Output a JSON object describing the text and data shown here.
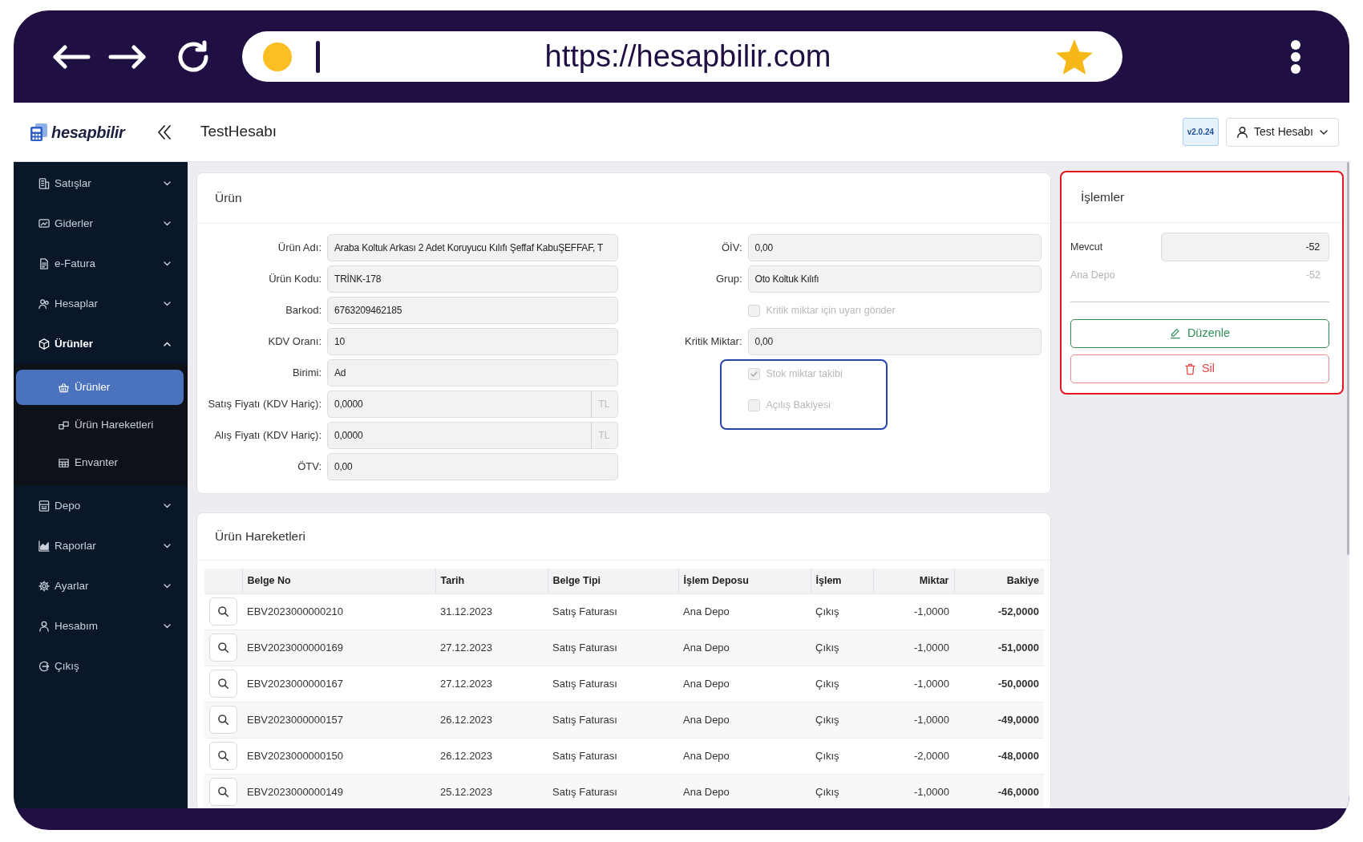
{
  "browser": {
    "url": "https://hesapbilir.com"
  },
  "header": {
    "logo": "hesapbilir",
    "title": "TestHesabı",
    "version": "v2.0.24",
    "user": "Test Hesabı"
  },
  "sidebar": {
    "items": [
      {
        "kind": "menu",
        "label": "Satışlar",
        "expanded": false
      },
      {
        "kind": "menu",
        "label": "Giderler",
        "expanded": false
      },
      {
        "kind": "menu",
        "label": "e-Fatura",
        "expanded": false
      },
      {
        "kind": "menu",
        "label": "Hesaplar",
        "expanded": false
      },
      {
        "kind": "menu",
        "label": "Ürünler",
        "expanded": true,
        "children": [
          {
            "label": "Ürünler",
            "selected": true
          },
          {
            "label": "Ürün Hareketleri",
            "selected": false
          },
          {
            "label": "Envanter",
            "selected": false
          }
        ]
      },
      {
        "kind": "menu",
        "label": "Depo",
        "expanded": false
      },
      {
        "kind": "menu",
        "label": "Raporlar",
        "expanded": false
      },
      {
        "kind": "menu",
        "label": "Ayarlar",
        "expanded": false
      },
      {
        "kind": "menu",
        "label": "Hesabım",
        "expanded": false
      },
      {
        "kind": "link",
        "label": "Çıkış"
      }
    ]
  },
  "product": {
    "title": "Ürün",
    "left_fields": [
      {
        "label": "Ürün Adı:",
        "value": "Araba Koltuk Arkası 2 Adet Koruyucu Kılıfı Şeffaf KabuŞEFFAF, T"
      },
      {
        "label": "Ürün Kodu:",
        "value": "TRİNK-178"
      },
      {
        "label": "Barkod:",
        "value": "6763209462185"
      },
      {
        "label": "KDV Oranı:",
        "value": "10"
      },
      {
        "label": "Birimi:",
        "value": "Ad"
      },
      {
        "label": "Satış Fiyatı (KDV Hariç):",
        "value": "0,0000",
        "suffix": "TL"
      },
      {
        "label": "Alış Fiyatı (KDV Hariç):",
        "value": "0,0000",
        "suffix": "TL"
      },
      {
        "label": "ÖTV:",
        "value": "0,00"
      }
    ],
    "right_fields": [
      {
        "kind": "field",
        "label": "ÖİV:",
        "value": "0,00"
      },
      {
        "kind": "field",
        "label": "Grup:",
        "value": "Oto Koltuk Kılıfı"
      },
      {
        "kind": "checkbox",
        "label": "Kritik miktar için uyarı gönder",
        "checked": false,
        "disabled": true
      },
      {
        "kind": "field",
        "label": "Kritik Miktar:",
        "value": "0,00"
      },
      {
        "kind": "group",
        "highlighted": true,
        "items": [
          {
            "label": "Stok miktar takibi",
            "checked": true,
            "disabled": true
          },
          {
            "label": "Açılış Bakiyesi",
            "checked": false,
            "disabled": true
          }
        ]
      }
    ]
  },
  "actions": {
    "title": "İşlemler",
    "highlighted": true,
    "stock_label": "Mevcut",
    "stock_value": "-52",
    "warehouses": [
      {
        "name": "Ana Depo",
        "value": "-52"
      }
    ],
    "buttons": [
      {
        "kind": "edit",
        "label": "Düzenle"
      },
      {
        "kind": "delete",
        "label": "Sil"
      }
    ]
  },
  "movements": {
    "title": "Ürün Hareketleri",
    "columns": [
      "Belge No",
      "Tarih",
      "Belge Tipi",
      "İşlem Deposu",
      "İşlem",
      "Miktar",
      "Bakiye"
    ],
    "rows": [
      [
        "EBV2023000000210",
        "31.12.2023",
        "Satış Faturası",
        "Ana Depo",
        "Çıkış",
        "-1,0000",
        "-52,0000"
      ],
      [
        "EBV2023000000169",
        "27.12.2023",
        "Satış Faturası",
        "Ana Depo",
        "Çıkış",
        "-1,0000",
        "-51,0000"
      ],
      [
        "EBV2023000000167",
        "27.12.2023",
        "Satış Faturası",
        "Ana Depo",
        "Çıkış",
        "-1,0000",
        "-50,0000"
      ],
      [
        "EBV2023000000157",
        "26.12.2023",
        "Satış Faturası",
        "Ana Depo",
        "Çıkış",
        "-1,0000",
        "-49,0000"
      ],
      [
        "EBV2023000000150",
        "26.12.2023",
        "Satış Faturası",
        "Ana Depo",
        "Çıkış",
        "-2,0000",
        "-48,0000"
      ],
      [
        "EBV2023000000149",
        "25.12.2023",
        "Satış Faturası",
        "Ana Depo",
        "Çıkış",
        "-1,0000",
        "-46,0000"
      ]
    ]
  }
}
